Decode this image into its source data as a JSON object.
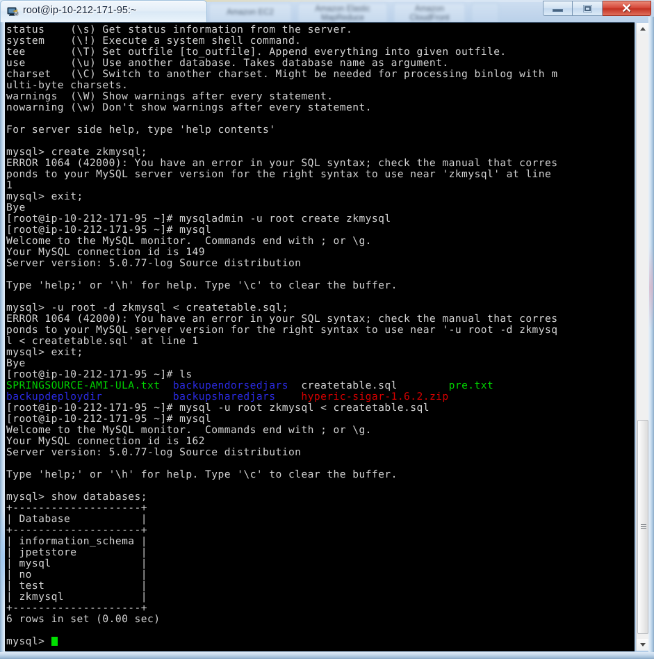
{
  "window": {
    "title": "root@ip-10-212-171-95:~",
    "icon": "terminal-icon",
    "minimize_label": "Minimize",
    "maximize_label": "Maximize",
    "close_label": "Close",
    "close_glyph": "✕"
  },
  "background_tabs": [
    {
      "label": "Amazon EC2"
    },
    {
      "label": "Amazon Elastic\nMapReduce"
    },
    {
      "label": "Amazon\nCloudFront"
    },
    {
      "label": ""
    }
  ],
  "colors": {
    "terminal_bg": "#000000",
    "text_white": "#d3d3d3",
    "text_green": "#00d200",
    "text_blue": "#2a2ae0",
    "text_red": "#d40000",
    "cursor_green": "#00e000",
    "titlebar_text": "#14243a",
    "close_button": "#c23122"
  },
  "scrollbar": {
    "up_arrow": "chevron-up-icon",
    "down_arrow": "chevron-down-icon",
    "thumb_top_pct": 63,
    "thumb_height_pct": 34
  },
  "terminal": {
    "prompt_shell": "[root@ip-10-212-171-95 ~]# ",
    "prompt_mysql": "mysql> ",
    "lines": [
      {
        "text": "status    (\\s) Get status information from the server."
      },
      {
        "text": "system    (\\!) Execute a system shell command."
      },
      {
        "text": "tee       (\\T) Set outfile [to_outfile]. Append everything into given outfile."
      },
      {
        "text": "use       (\\u) Use another database. Takes database name as argument."
      },
      {
        "text": "charset   (\\C) Switch to another charset. Might be needed for processing binlog with m"
      },
      {
        "text": "ulti-byte charsets."
      },
      {
        "text": "warnings  (\\W) Show warnings after every statement."
      },
      {
        "text": "nowarning (\\w) Don't show warnings after every statement."
      },
      {
        "text": ""
      },
      {
        "text": "For server side help, type 'help contents'"
      },
      {
        "text": ""
      },
      {
        "text": "mysql> create zkmysql;"
      },
      {
        "text": "ERROR 1064 (42000): You have an error in your SQL syntax; check the manual that corres"
      },
      {
        "text": "ponds to your MySQL server version for the right syntax to use near 'zkmysql' at line"
      },
      {
        "text": "1"
      },
      {
        "text": "mysql> exit;"
      },
      {
        "text": "Bye"
      },
      {
        "text": "[root@ip-10-212-171-95 ~]# mysqladmin -u root create zkmysql"
      },
      {
        "text": "[root@ip-10-212-171-95 ~]# mysql"
      },
      {
        "text": "Welcome to the MySQL monitor.  Commands end with ; or \\g."
      },
      {
        "text": "Your MySQL connection id is 149"
      },
      {
        "text": "Server version: 5.0.77-log Source distribution"
      },
      {
        "text": ""
      },
      {
        "text": "Type 'help;' or '\\h' for help. Type '\\c' to clear the buffer."
      },
      {
        "text": ""
      },
      {
        "text": "mysql> -u root -d zkmysql < createtable.sql;"
      },
      {
        "text": "ERROR 1064 (42000): You have an error in your SQL syntax; check the manual that corres"
      },
      {
        "text": "ponds to your MySQL server version for the right syntax to use near '-u root -d zkmysq"
      },
      {
        "text": "l < createtable.sql' at line 1"
      },
      {
        "text": "mysql> exit;"
      },
      {
        "text": "Bye"
      },
      {
        "text": "[root@ip-10-212-171-95 ~]# ls"
      },
      {
        "segments": [
          {
            "text": "SPRINGSOURCE-AMI-ULA.txt  ",
            "color": "green"
          },
          {
            "text": "backupendorsedjars  ",
            "color": "blue"
          },
          {
            "text": "createtable.sql        ",
            "color": "white"
          },
          {
            "text": "pre.txt",
            "color": "green"
          }
        ]
      },
      {
        "segments": [
          {
            "text": "backupdeploydir           ",
            "color": "blue"
          },
          {
            "text": "backupsharedjars    ",
            "color": "blue"
          },
          {
            "text": "hyperic-sigar-1.6.2.zip",
            "color": "red"
          }
        ]
      },
      {
        "text": "[root@ip-10-212-171-95 ~]# mysql -u root zkmysql < createtable.sql"
      },
      {
        "text": "[root@ip-10-212-171-95 ~]# mysql"
      },
      {
        "text": "Welcome to the MySQL monitor.  Commands end with ; or \\g."
      },
      {
        "text": "Your MySQL connection id is 162"
      },
      {
        "text": "Server version: 5.0.77-log Source distribution"
      },
      {
        "text": ""
      },
      {
        "text": "Type 'help;' or '\\h' for help. Type '\\c' to clear the buffer."
      },
      {
        "text": ""
      },
      {
        "text": "mysql> show databases;"
      },
      {
        "text": "+--------------------+"
      },
      {
        "text": "| Database           |"
      },
      {
        "text": "+--------------------+"
      },
      {
        "text": "| information_schema |"
      },
      {
        "text": "| jpetstore          |"
      },
      {
        "text": "| mysql              |"
      },
      {
        "text": "| no                 |"
      },
      {
        "text": "| test               |"
      },
      {
        "text": "| zkmysql            |"
      },
      {
        "text": "+--------------------+"
      },
      {
        "text": "6 rows in set (0.00 sec)"
      },
      {
        "text": ""
      },
      {
        "text": "mysql> ",
        "cursor": true
      }
    ],
    "databases_table": {
      "type": "table",
      "header": "Database",
      "rows": [
        "information_schema",
        "jpetstore",
        "mysql",
        "no",
        "test",
        "zkmysql"
      ],
      "footer": "6 rows in set (0.00 sec)"
    },
    "ls_output": {
      "files": [
        {
          "name": "SPRINGSOURCE-AMI-ULA.txt",
          "color": "green"
        },
        {
          "name": "backupendorsedjars",
          "color": "blue"
        },
        {
          "name": "createtable.sql",
          "color": "white"
        },
        {
          "name": "pre.txt",
          "color": "green"
        },
        {
          "name": "backupdeploydir",
          "color": "blue"
        },
        {
          "name": "backupsharedjars",
          "color": "blue"
        },
        {
          "name": "hyperic-sigar-1.6.2.zip",
          "color": "red"
        }
      ]
    }
  }
}
